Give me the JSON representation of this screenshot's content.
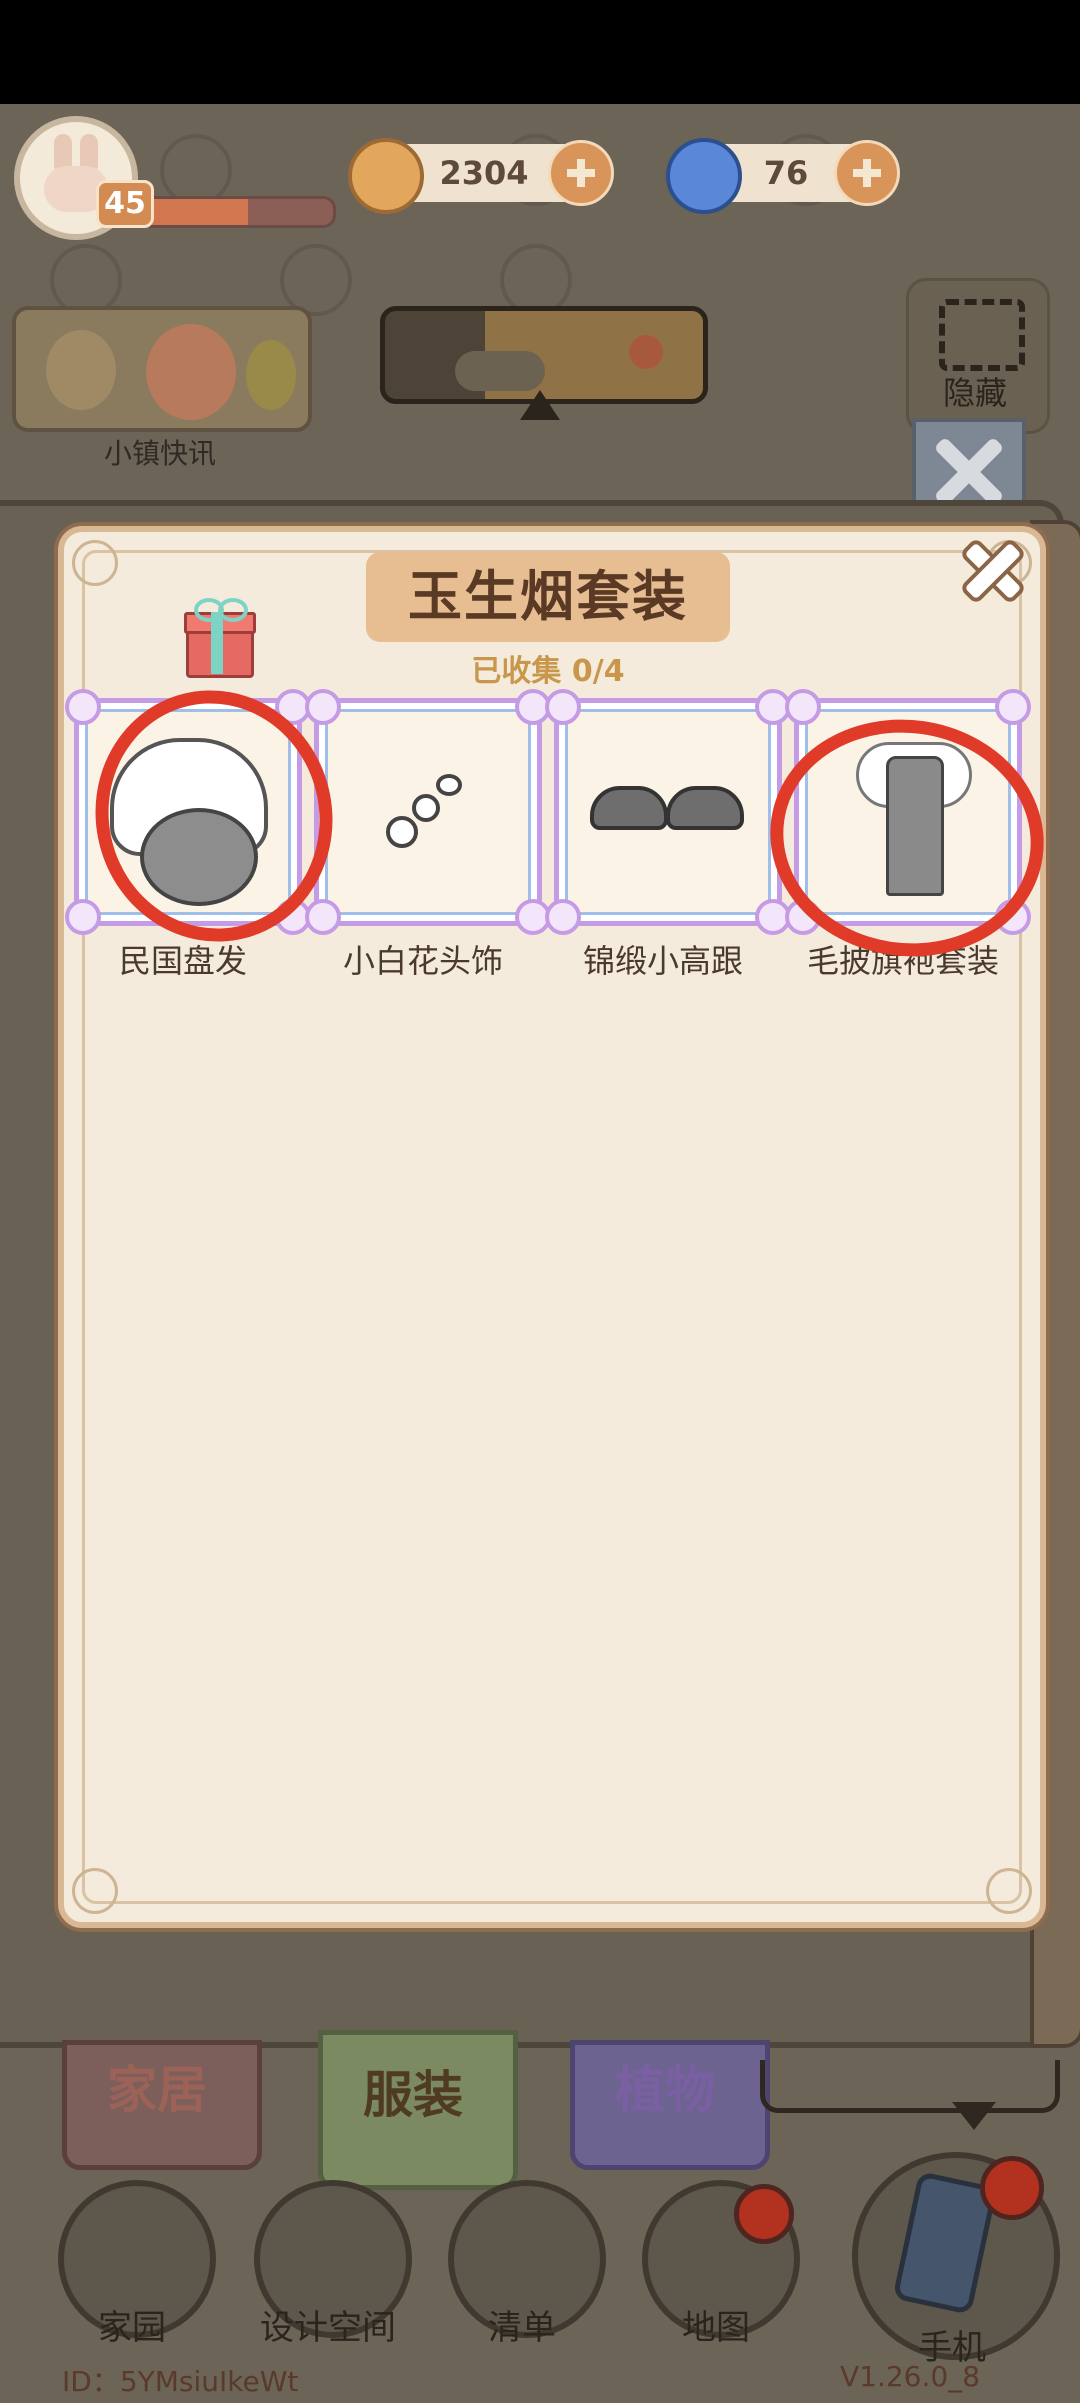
{
  "hud": {
    "level": "45",
    "xp_fraction": 0.55,
    "coins": "2304",
    "gems": "76"
  },
  "top": {
    "news_label": "小镇快讯",
    "hide_label": "隐藏"
  },
  "collection": {
    "title": "玉生烟套装",
    "progress": "已收集 0/4",
    "items": [
      {
        "label": "民国盘发"
      },
      {
        "label": "小白花头饰"
      },
      {
        "label": "锦缎小高跟"
      },
      {
        "label": "毛披旗袍套装"
      }
    ]
  },
  "tabs": [
    {
      "label": "家居"
    },
    {
      "label": "服装"
    },
    {
      "label": "植物"
    }
  ],
  "nav": [
    {
      "label": "家园"
    },
    {
      "label": "设计空间"
    },
    {
      "label": "清单"
    },
    {
      "label": "地图"
    },
    {
      "label": "手机"
    }
  ],
  "footer": {
    "id_text": "ID：5YMsiuIkeWt",
    "version_text": "V1.26.0_8"
  },
  "colors": {
    "annotation_red": "#e03b28",
    "slot_border": "#c69be6",
    "title_plate": "#e7bd92"
  }
}
